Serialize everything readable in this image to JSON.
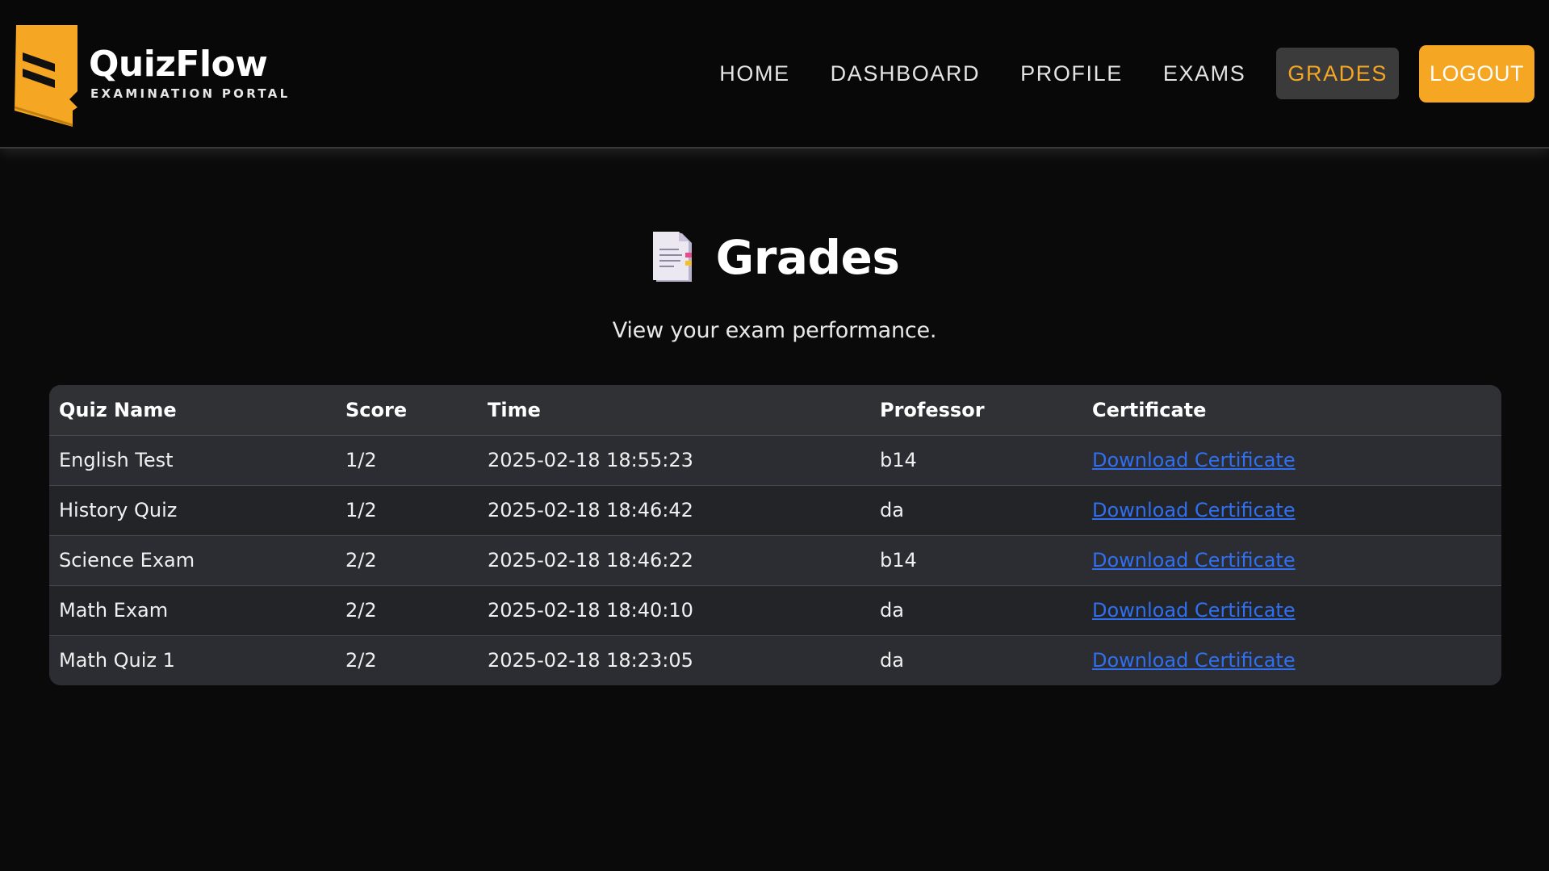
{
  "header": {
    "brand_name": "QuizFlow",
    "brand_sub": "EXAMINATION PORTAL",
    "nav": [
      {
        "label": "HOME"
      },
      {
        "label": "DASHBOARD"
      },
      {
        "label": "PROFILE"
      },
      {
        "label": "EXAMS"
      },
      {
        "label": "GRADES",
        "active": true
      }
    ],
    "logout_label": "LOGOUT",
    "accent_color": "#f5a623"
  },
  "page": {
    "title_icon": "document-icon",
    "title": "Grades",
    "subtitle": "View your exam performance."
  },
  "table": {
    "columns": [
      "Quiz Name",
      "Score",
      "Time",
      "Professor",
      "Certificate"
    ],
    "rows": [
      {
        "quiz": "English Test",
        "score": "1/2",
        "time": "2025-02-18 18:55:23",
        "professor": "b14",
        "certificate": "Download Certificate"
      },
      {
        "quiz": "History Quiz",
        "score": "1/2",
        "time": "2025-02-18 18:46:42",
        "professor": "da",
        "certificate": "Download Certificate"
      },
      {
        "quiz": "Science Exam",
        "score": "2/2",
        "time": "2025-02-18 18:46:22",
        "professor": "b14",
        "certificate": "Download Certificate"
      },
      {
        "quiz": "Math Exam",
        "score": "2/2",
        "time": "2025-02-18 18:40:10",
        "professor": "da",
        "certificate": "Download Certificate"
      },
      {
        "quiz": "Math Quiz 1",
        "score": "2/2",
        "time": "2025-02-18 18:23:05",
        "professor": "da",
        "certificate": "Download Certificate"
      }
    ],
    "link_color": "#2f6ff0"
  }
}
